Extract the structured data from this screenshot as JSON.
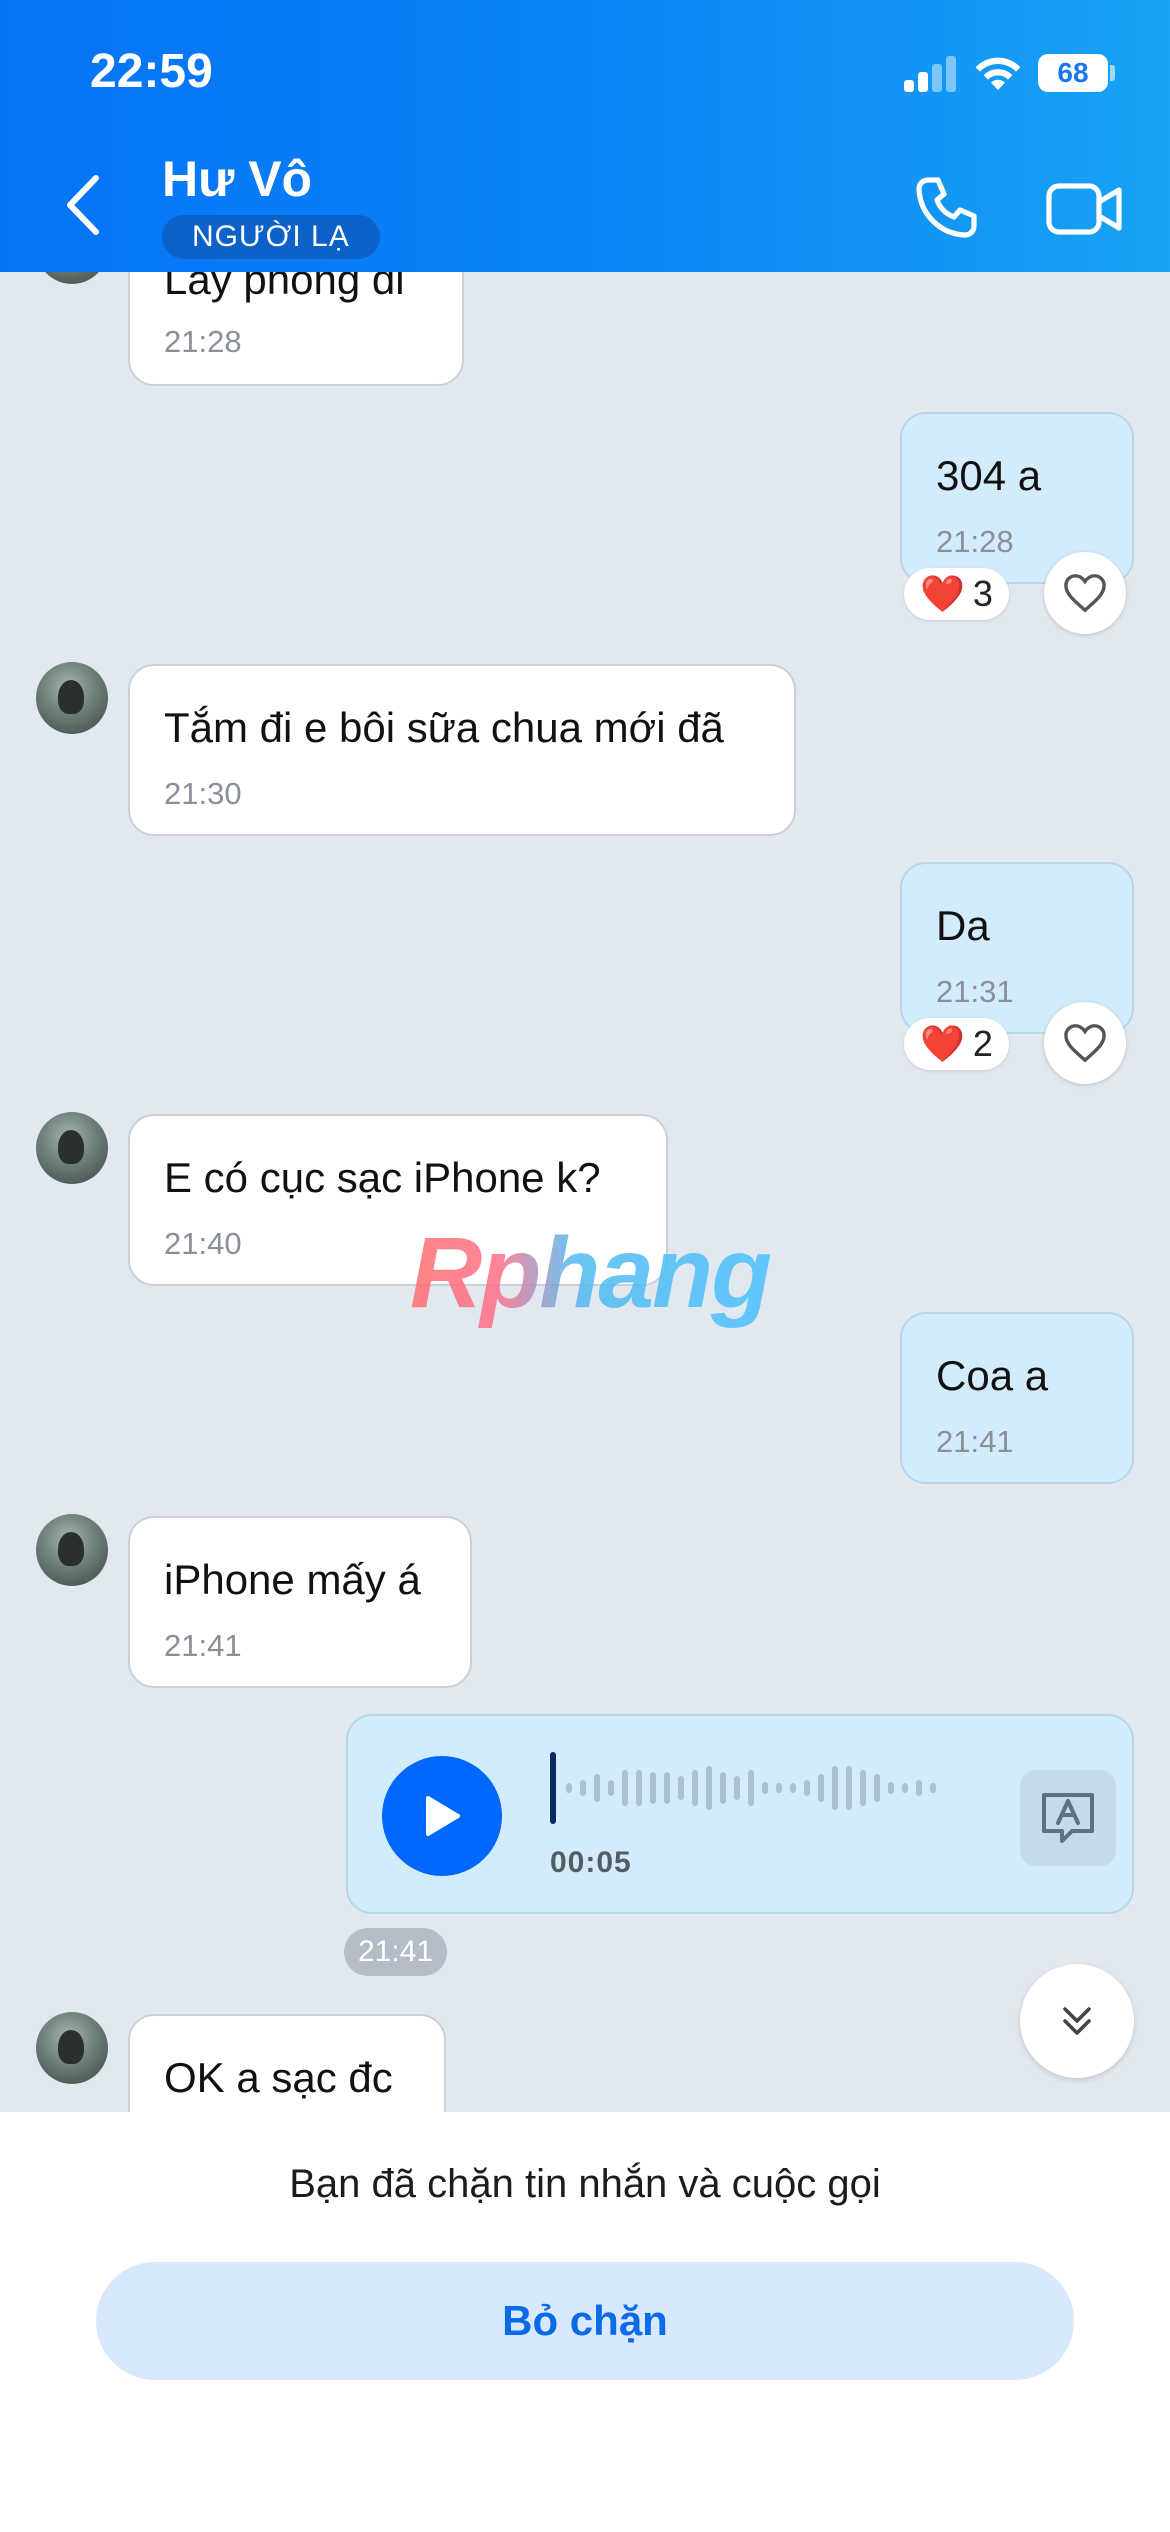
{
  "status_bar": {
    "time": "22:59",
    "battery": "68"
  },
  "header": {
    "contact_name": "Hư Vô",
    "badge": "NGƯỜI LẠ"
  },
  "messages": [
    {
      "direction": "in",
      "text": "Lấy phòng đi",
      "time": "21:28"
    },
    {
      "direction": "out",
      "text": "304 a",
      "time": "21:28",
      "reaction": {
        "emoji": "❤️",
        "count": "3"
      }
    },
    {
      "direction": "in",
      "text": "Tắm đi e bôi sữa chua mới đã",
      "time": "21:30"
    },
    {
      "direction": "out",
      "text": "Da",
      "time": "21:31",
      "reaction": {
        "emoji": "❤️",
        "count": "2"
      }
    },
    {
      "direction": "in",
      "text": "E có cục sạc iPhone k?",
      "time": "21:40"
    },
    {
      "direction": "out",
      "text": "Coa a",
      "time": "21:41"
    },
    {
      "direction": "in",
      "text": "iPhone mấy á",
      "time": "21:41"
    },
    {
      "direction": "in",
      "text": "OK a sạc đc"
    }
  ],
  "voice_message": {
    "duration": "00:05",
    "time": "21:41"
  },
  "watermark": "Rphang",
  "footer": {
    "blocked_notice": "Bạn đã chặn tin nhắn và cuộc gọi",
    "unblock_label": "Bỏ chặn"
  },
  "colors": {
    "accent": "#0068ff",
    "header_start": "#0573f5",
    "header_end": "#18a3f3",
    "out_bubble": "#d3ecfb"
  }
}
